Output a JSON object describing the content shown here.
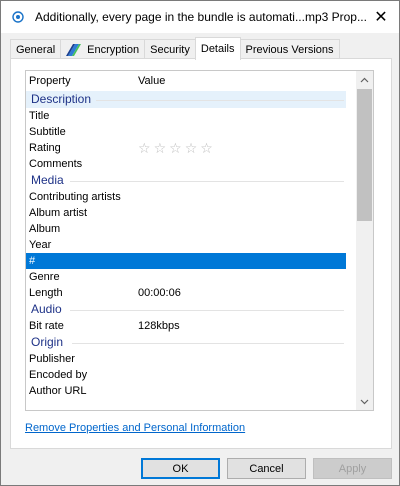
{
  "window": {
    "title": "Additionally, every page in the bundle is automati...mp3 Prop...",
    "title_icon": "media-file-icon",
    "close_glyph": "✕"
  },
  "tabs": [
    {
      "label": "General",
      "active": false
    },
    {
      "label": "Encryption",
      "active": false,
      "icon": "encryption-icon"
    },
    {
      "label": "Security",
      "active": false
    },
    {
      "label": "Details",
      "active": true
    },
    {
      "label": "Previous Versions",
      "active": false
    }
  ],
  "list": {
    "header": {
      "property": "Property",
      "value": "Value"
    },
    "groups": {
      "description": "Description",
      "media": "Media",
      "audio": "Audio",
      "origin": "Origin"
    },
    "rows": {
      "title": {
        "name": "Title",
        "value": ""
      },
      "subtitle": {
        "name": "Subtitle",
        "value": ""
      },
      "rating": {
        "name": "Rating",
        "value": "",
        "stars": 0,
        "max_stars": 5
      },
      "comments": {
        "name": "Comments",
        "value": ""
      },
      "contributing_artists": {
        "name": "Contributing artists",
        "value": ""
      },
      "album_artist": {
        "name": "Album artist",
        "value": ""
      },
      "album": {
        "name": "Album",
        "value": ""
      },
      "year": {
        "name": "Year",
        "value": ""
      },
      "track": {
        "name": "#",
        "value": "",
        "selected": true
      },
      "genre": {
        "name": "Genre",
        "value": ""
      },
      "length": {
        "name": "Length",
        "value": "00:00:06"
      },
      "bit_rate": {
        "name": "Bit rate",
        "value": "128kbps"
      },
      "publisher": {
        "name": "Publisher",
        "value": ""
      },
      "encoded_by": {
        "name": "Encoded by",
        "value": ""
      },
      "author_url": {
        "name": "Author URL",
        "value": ""
      }
    },
    "star_glyph": "☆"
  },
  "links": {
    "remove_properties": "Remove Properties and Personal Information"
  },
  "buttons": {
    "ok": "OK",
    "cancel": "Cancel",
    "apply": "Apply",
    "apply_enabled": false
  },
  "colors": {
    "selection": "#0078d7",
    "group_header": "#1e3287",
    "link": "#0066cc"
  }
}
